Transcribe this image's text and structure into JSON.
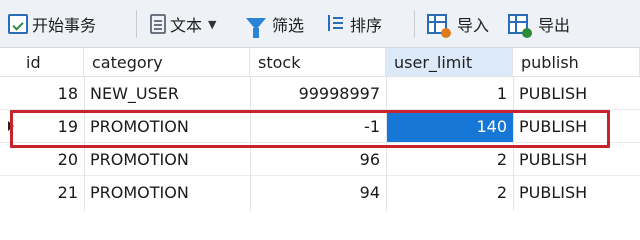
{
  "toolbar": {
    "transaction_label": "开始事务",
    "text_label": "文本",
    "filter_label": "筛选",
    "sort_label": "排序",
    "import_label": "导入",
    "export_label": "导出"
  },
  "table": {
    "columns": [
      "id",
      "category",
      "stock",
      "user_limit",
      "publish"
    ],
    "selected_column": "user_limit",
    "rows": [
      {
        "id": "18",
        "category": "NEW_USER",
        "stock": "99998997",
        "user_limit": "1",
        "publish": "PUBLISH"
      },
      {
        "id": "19",
        "category": "PROMOTION",
        "stock": "-1",
        "user_limit": "140",
        "publish": "PUBLISH"
      },
      {
        "id": "20",
        "category": "PROMOTION",
        "stock": "96",
        "user_limit": "2",
        "publish": "PUBLISH"
      },
      {
        "id": "21",
        "category": "PROMOTION",
        "stock": "94",
        "user_limit": "2",
        "publish": "PUBLISH"
      }
    ],
    "active_row": "19",
    "active_cell": "user_limit"
  },
  "colors": {
    "accent": "#1677d6",
    "highlight_border": "#c8232c",
    "selected_header": "#dbe9f8"
  }
}
